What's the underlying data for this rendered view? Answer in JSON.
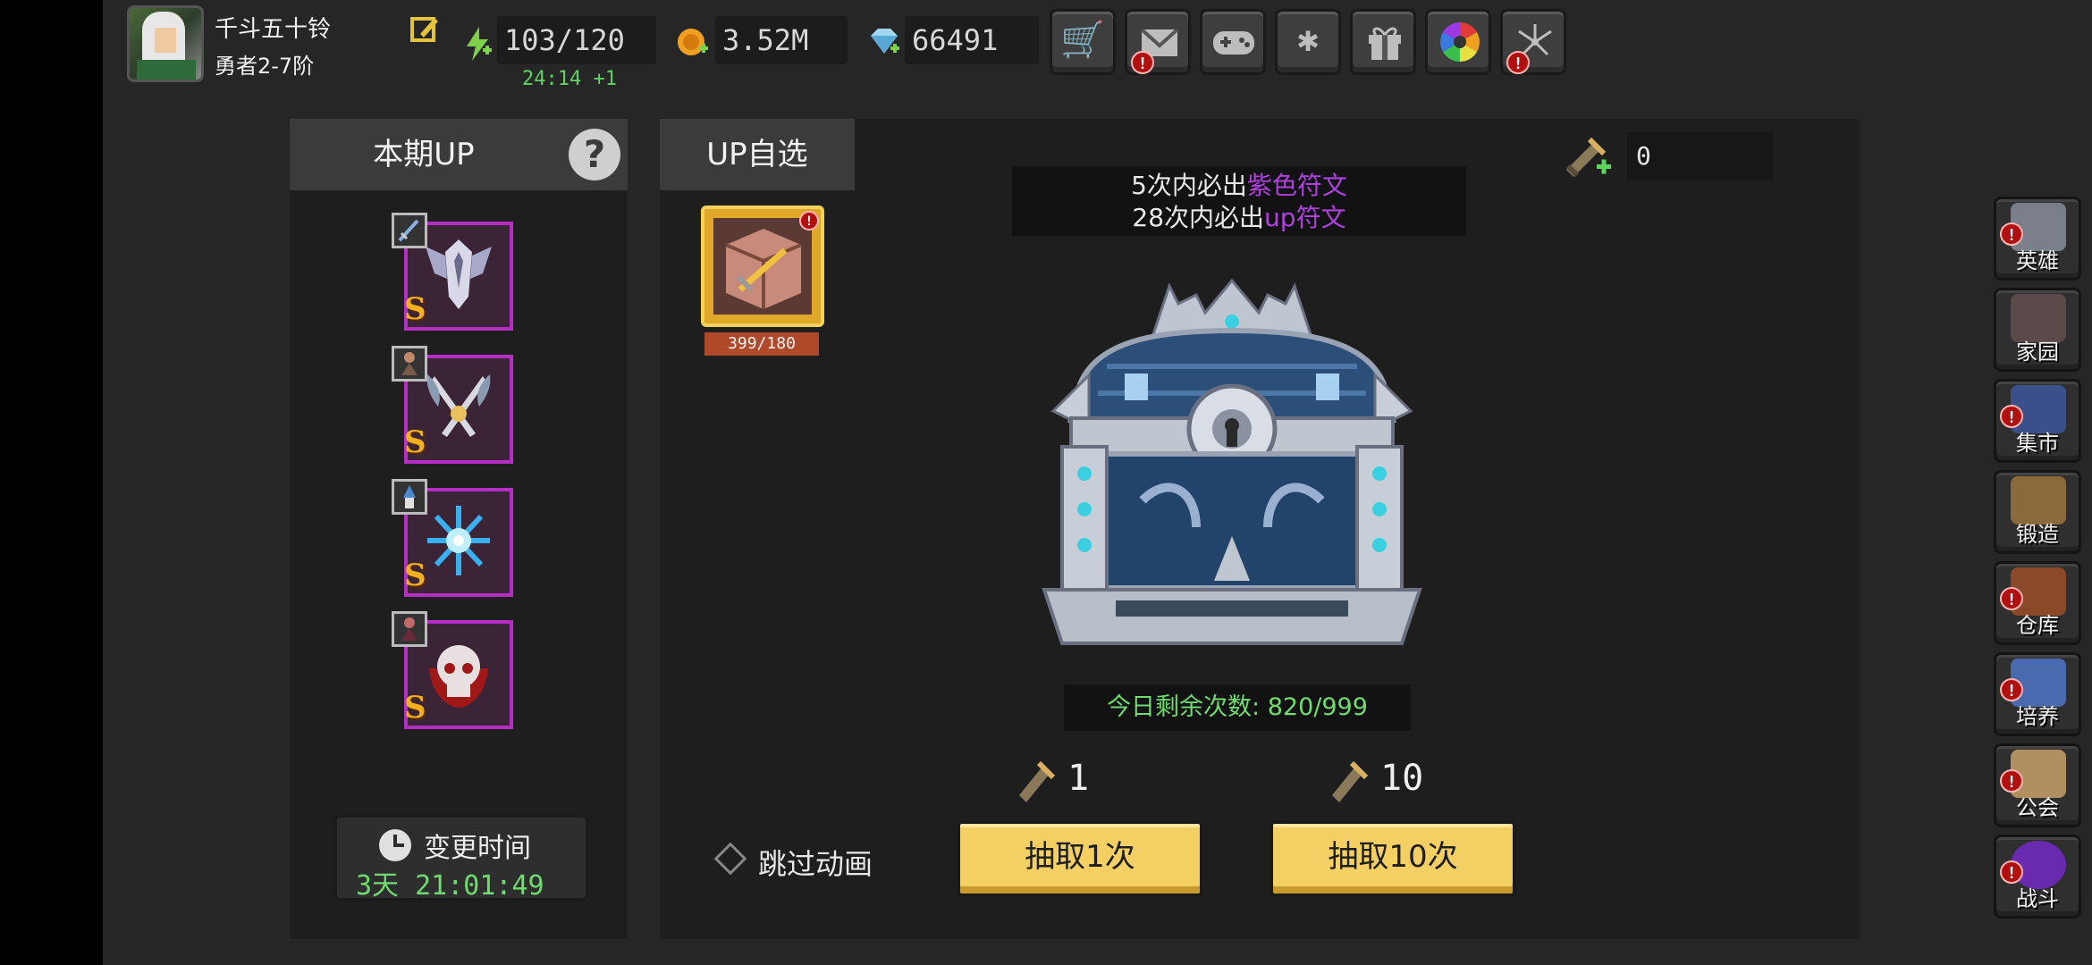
{
  "player": {
    "name": "千斗五十铃",
    "rank": "勇者2-7阶"
  },
  "resources": {
    "stamina": "103/120",
    "stamina_timer": "24:14 +1",
    "gold": "3.52M",
    "gems": "66491"
  },
  "top_buttons": [
    {
      "name": "shop",
      "icon": "cart-icon",
      "alert": false
    },
    {
      "name": "mail",
      "icon": "mail-icon",
      "alert": true
    },
    {
      "name": "gamepad",
      "icon": "gamepad-icon",
      "alert": false
    },
    {
      "name": "settings",
      "icon": "gear-icon",
      "alert": false
    },
    {
      "name": "gift",
      "icon": "gift-icon",
      "alert": false
    },
    {
      "name": "gacha-wheel",
      "icon": "color-wheel-icon",
      "alert": false
    },
    {
      "name": "fireworks",
      "icon": "fireworks-icon",
      "alert": true
    }
  ],
  "left_panel": {
    "title": "本期UP",
    "help": "?",
    "runes": [
      {
        "grade": "S",
        "hero_icon": "hero-sword-icon",
        "art_icon": "winged-armor-icon"
      },
      {
        "grade": "S",
        "hero_icon": "hero-rogue-icon",
        "art_icon": "crossed-blades-icon"
      },
      {
        "grade": "S",
        "hero_icon": "hero-mage-icon",
        "art_icon": "ice-star-icon"
      },
      {
        "grade": "S",
        "hero_icon": "hero-dark-icon",
        "art_icon": "skull-icon"
      }
    ],
    "change_label": "变更时间",
    "change_time": "3天 21:01:49"
  },
  "main": {
    "tab_label": "UP自选",
    "selected_count": "399/180",
    "ticket_count": "0",
    "notice": {
      "line1_prefix": "5次内必出",
      "line1_highlight": "紫色符文",
      "line2_prefix": "28次内必出",
      "line2_highlight": "up符文"
    },
    "remaining": "今日剩余次数: 820/999",
    "cost_single": "1",
    "cost_ten": "10",
    "skip_label": "跳过动画",
    "draw1_label": "抽取1次",
    "draw10_label": "抽取10次"
  },
  "sidebar": [
    {
      "label": "英雄",
      "icon": "hero-helmet-icon",
      "alert": true,
      "color": "#7a7f8a"
    },
    {
      "label": "家园",
      "icon": "castle-icon",
      "alert": false,
      "color": "#5b4a4a"
    },
    {
      "label": "集市",
      "icon": "market-icon",
      "alert": true,
      "color": "#3b4f8a"
    },
    {
      "label": "锻造",
      "icon": "anvil-icon",
      "alert": false,
      "color": "#8a6a3a"
    },
    {
      "label": "仓库",
      "icon": "chest-warrior-icon",
      "alert": true,
      "color": "#8a4a2a"
    },
    {
      "label": "培养",
      "icon": "trophy-icon",
      "alert": true,
      "color": "#4a6ab0"
    },
    {
      "label": "公会",
      "icon": "guild-icon",
      "alert": true,
      "color": "#b09060"
    },
    {
      "label": "战斗",
      "icon": "portal-icon",
      "alert": true,
      "color": "#6a2ab0"
    }
  ],
  "colors": {
    "accent_yellow": "#f3cf64",
    "epic_purple": "#b040e0",
    "timer_green": "#6fdc6f",
    "alert_red": "#b01010"
  }
}
